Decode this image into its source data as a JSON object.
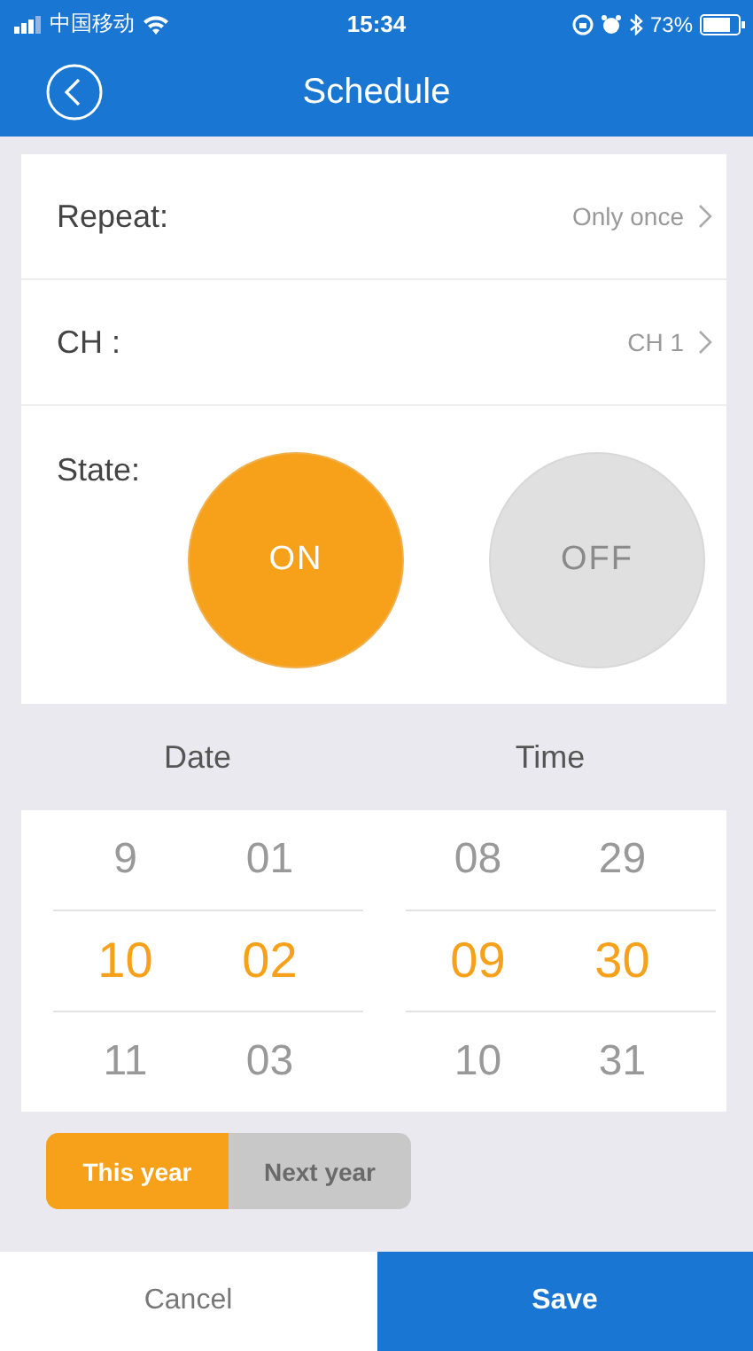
{
  "status_bar": {
    "carrier": "中国移动",
    "time": "15:34",
    "battery": "73%"
  },
  "header": {
    "title": "Schedule"
  },
  "settings": [
    {
      "label": "Repeat:",
      "value": "Only once"
    },
    {
      "label": "CH :",
      "value": "CH 1"
    }
  ],
  "state": {
    "label": "State:",
    "options": [
      {
        "label": "ON",
        "selected": true
      },
      {
        "label": "OFF",
        "selected": false
      }
    ]
  },
  "pickers": [
    {
      "label": "Date",
      "columns": [
        {
          "items": [
            {
              "text": "9",
              "selected": false
            },
            {
              "text": "10",
              "selected": true
            },
            {
              "text": "11",
              "selected": false
            }
          ]
        },
        {
          "items": [
            {
              "text": "01",
              "selected": false
            },
            {
              "text": "02",
              "selected": true
            },
            {
              "text": "03",
              "selected": false
            }
          ]
        }
      ]
    },
    {
      "label": "Time",
      "columns": [
        {
          "items": [
            {
              "text": "08",
              "selected": false
            },
            {
              "text": "09",
              "selected": true
            },
            {
              "text": "10",
              "selected": false
            }
          ]
        },
        {
          "items": [
            {
              "text": "29",
              "selected": false
            },
            {
              "text": "30",
              "selected": true
            },
            {
              "text": "31",
              "selected": false
            }
          ]
        }
      ]
    }
  ],
  "year_toggle": [
    {
      "label": "This year",
      "selected": true
    },
    {
      "label": "Next year",
      "selected": false
    }
  ],
  "buttons": [
    {
      "label": "Cancel",
      "kind": "secondary"
    },
    {
      "label": "Save",
      "kind": "primary"
    }
  ]
}
